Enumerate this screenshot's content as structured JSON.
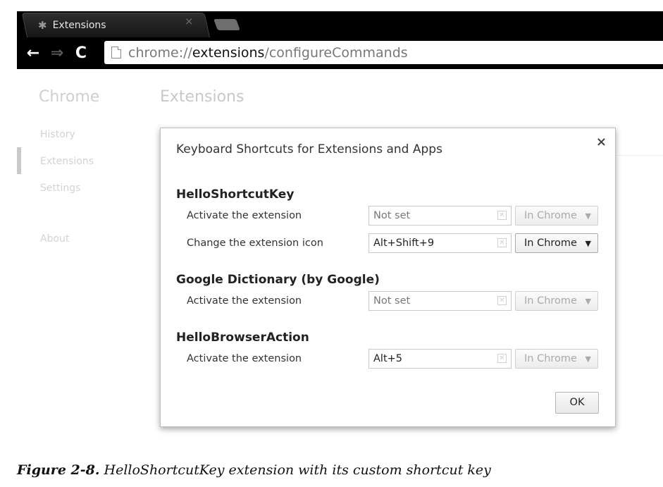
{
  "browser": {
    "tab": {
      "icon": "puzzle-piece-icon",
      "title": "Extensions",
      "close": "×"
    },
    "nav": {
      "back": "←",
      "forward": "⇒",
      "reload": "C"
    },
    "address": {
      "scheme": "chrome://",
      "host": "extensions",
      "path": "/configureCommands"
    }
  },
  "page": {
    "sidebar_title": "Chrome",
    "main_title": "Extensions",
    "sidebar_items": [
      "History",
      "Extensions",
      "Settings",
      "About"
    ]
  },
  "dialog": {
    "title": "Keyboard Shortcuts for Extensions and Apps",
    "close": "×",
    "extensions": [
      {
        "name": "HelloShortcutKey",
        "commands": [
          {
            "label": "Activate the extension",
            "shortcut": "Not set",
            "scope": "In Chrome",
            "scope_enabled": false
          },
          {
            "label": "Change the extension icon",
            "shortcut": "Alt+Shift+9",
            "scope": "In Chrome",
            "scope_enabled": true
          }
        ]
      },
      {
        "name": "Google Dictionary (by Google)",
        "commands": [
          {
            "label": "Activate the extension",
            "shortcut": "Not set",
            "scope": "In Chrome",
            "scope_enabled": false
          }
        ]
      },
      {
        "name": "HelloBrowserAction",
        "commands": [
          {
            "label": "Activate the extension",
            "shortcut": "Alt+5",
            "scope": "In Chrome",
            "scope_enabled": false
          }
        ]
      }
    ],
    "ok_label": "OK"
  },
  "caption": {
    "figure": "Figure 2-8.",
    "text": "HelloShortcutKey extension with its custom shortcut key"
  }
}
